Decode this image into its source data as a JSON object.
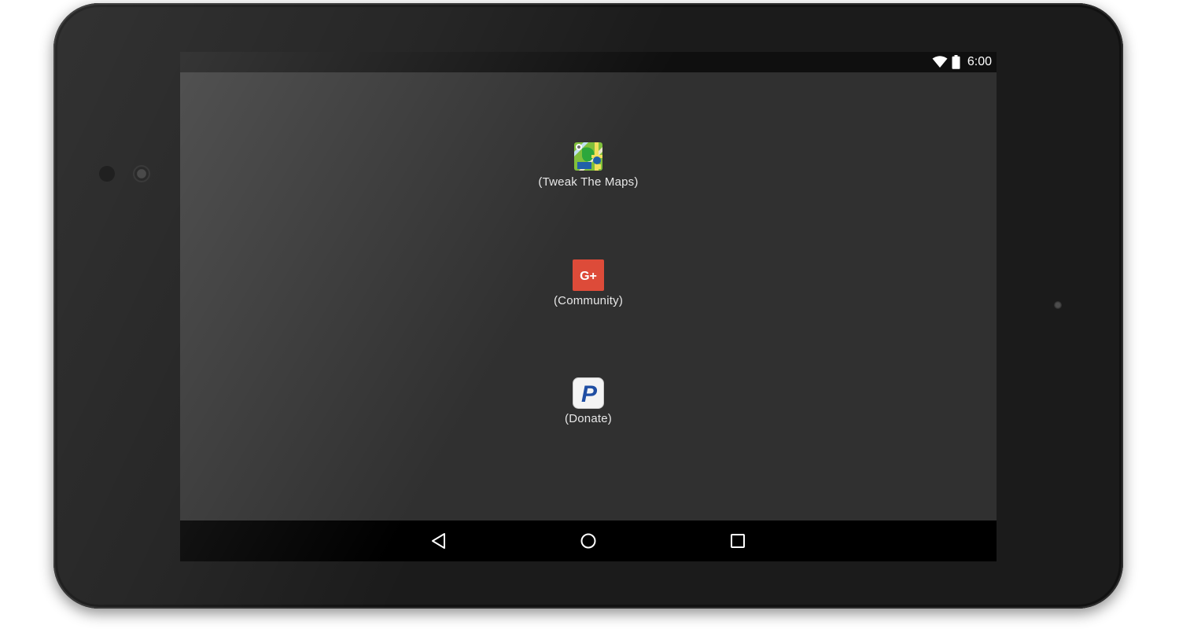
{
  "status_bar": {
    "time": "6:00",
    "icons": [
      "wifi-icon",
      "battery-icon"
    ]
  },
  "menu": {
    "items": [
      {
        "label": "(Tweak The Maps)",
        "icon": "maps-tweaker-app-icon"
      },
      {
        "label": "(Community)",
        "icon": "google-plus-icon",
        "icon_text": "G+",
        "icon_color": "#dd4b39"
      },
      {
        "label": "(Donate)",
        "icon": "paypal-icon",
        "icon_text": "P",
        "icon_color": "#1f4ea3"
      }
    ]
  },
  "nav_bar": {
    "buttons": [
      "back-icon",
      "home-icon",
      "recents-icon"
    ]
  },
  "colors": {
    "screen_background": "#303030",
    "status_bar": "#0f0f0f",
    "nav_bar": "#000000",
    "label_text": "#e8e8e8"
  }
}
